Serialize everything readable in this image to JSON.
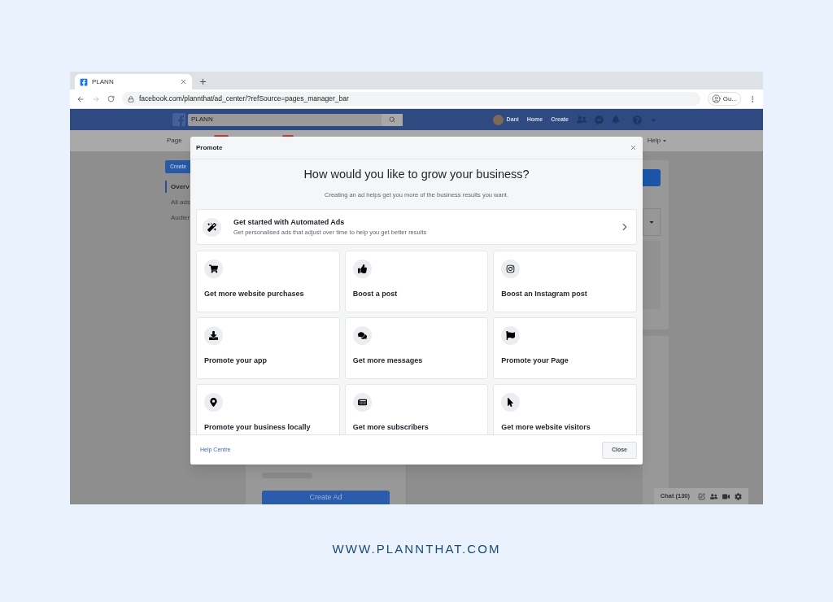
{
  "browser": {
    "tab_title": "PLANN",
    "url": "facebook.com/plannthat/ad_center/?refSource=pages_manager_bar",
    "profile": "Gu..."
  },
  "facebook_bar": {
    "search_value": "PLANN",
    "user": "Dani",
    "links": [
      "Home",
      "Create"
    ]
  },
  "subnav": {
    "items": [
      "Page",
      "Help"
    ]
  },
  "sidebar": {
    "button": "Create",
    "items": [
      {
        "label": "Overv",
        "selected": true
      },
      {
        "label": "All ads",
        "selected": false
      },
      {
        "label": "Audier",
        "selected": false
      }
    ]
  },
  "main": {
    "button": "Create Ad"
  },
  "chat": {
    "label": "Chat (130)"
  },
  "modal": {
    "title": "Promote",
    "heading": "How would you like to grow your business?",
    "subheading": "Creating an ad helps get you more of the business results you want.",
    "automated": {
      "title": "Get started with Automated Ads",
      "description": "Get personalised ads that adjust over time to help you get better results"
    },
    "options": [
      {
        "kind": "cart",
        "label": "Get more website purchases"
      },
      {
        "kind": "like",
        "label": "Boost a post"
      },
      {
        "kind": "instagram",
        "label": "Boost an Instagram post"
      },
      {
        "kind": "download",
        "label": "Promote your app"
      },
      {
        "kind": "messages",
        "label": "Get more messages"
      },
      {
        "kind": "flag",
        "label": "Promote your Page"
      },
      {
        "kind": "pin",
        "label": "Promote your business locally"
      },
      {
        "kind": "layout",
        "label": "Get more subscribers"
      },
      {
        "kind": "pointer",
        "label": "Get more website visitors"
      }
    ],
    "footer": {
      "link": "Help Centre",
      "button": "Close"
    }
  },
  "caption": "WWW.PLANNTHAT.COM"
}
